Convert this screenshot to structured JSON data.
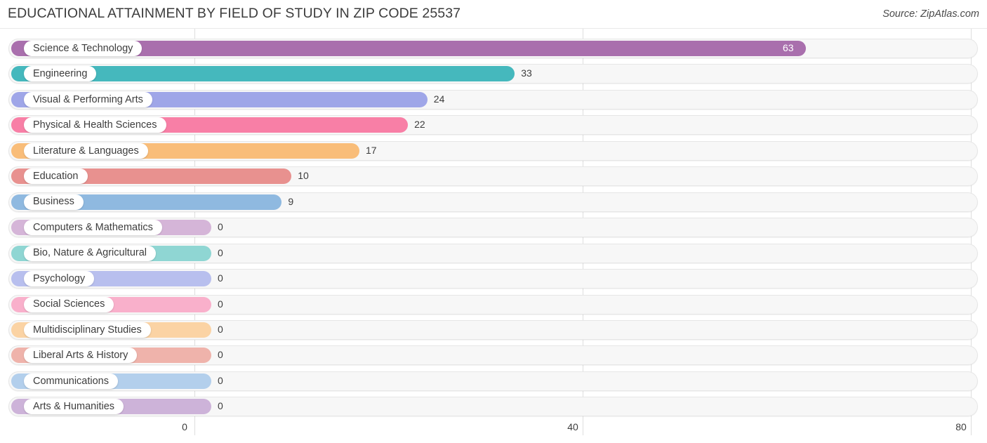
{
  "header": {
    "title": "EDUCATIONAL ATTAINMENT BY FIELD OF STUDY IN ZIP CODE 25537",
    "source": "Source: ZipAtlas.com"
  },
  "chart_data": {
    "type": "bar",
    "orientation": "horizontal",
    "title": "EDUCATIONAL ATTAINMENT BY FIELD OF STUDY IN ZIP CODE 25537",
    "xlabel": "",
    "ylabel": "",
    "xlim": [
      0,
      80
    ],
    "xticks": [
      0,
      40,
      80
    ],
    "xtick_labels": [
      "0",
      "40",
      "80"
    ],
    "grid": true,
    "legend": false,
    "categories": [
      "Science & Technology",
      "Engineering",
      "Visual & Performing Arts",
      "Physical & Health Sciences",
      "Literature & Languages",
      "Education",
      "Business",
      "Computers & Mathematics",
      "Bio, Nature & Agricultural",
      "Psychology",
      "Social Sciences",
      "Multidisciplinary Studies",
      "Liberal Arts & History",
      "Communications",
      "Arts & Humanities"
    ],
    "values": [
      63,
      33,
      24,
      22,
      17,
      10,
      9,
      0,
      0,
      0,
      0,
      0,
      0,
      0,
      0
    ],
    "value_labels": [
      "63",
      "33",
      "24",
      "22",
      "17",
      "10",
      "9",
      "0",
      "0",
      "0",
      "0",
      "0",
      "0",
      "0",
      "0"
    ],
    "colors": [
      "#a96fad",
      "#45b8bd",
      "#9fa6e8",
      "#f87fa6",
      "#f9bd79",
      "#e8918f",
      "#8fb9e0",
      "#d5b5d8",
      "#8fd6d3",
      "#b8bfee",
      "#f9b0cb",
      "#fbd3a4",
      "#efb3ab",
      "#b3cfec",
      "#cdb3d9"
    ]
  },
  "axis": {
    "ticks": [
      {
        "label": "0",
        "value": 0
      },
      {
        "label": "40",
        "value": 40
      },
      {
        "label": "80",
        "value": 80
      }
    ]
  }
}
